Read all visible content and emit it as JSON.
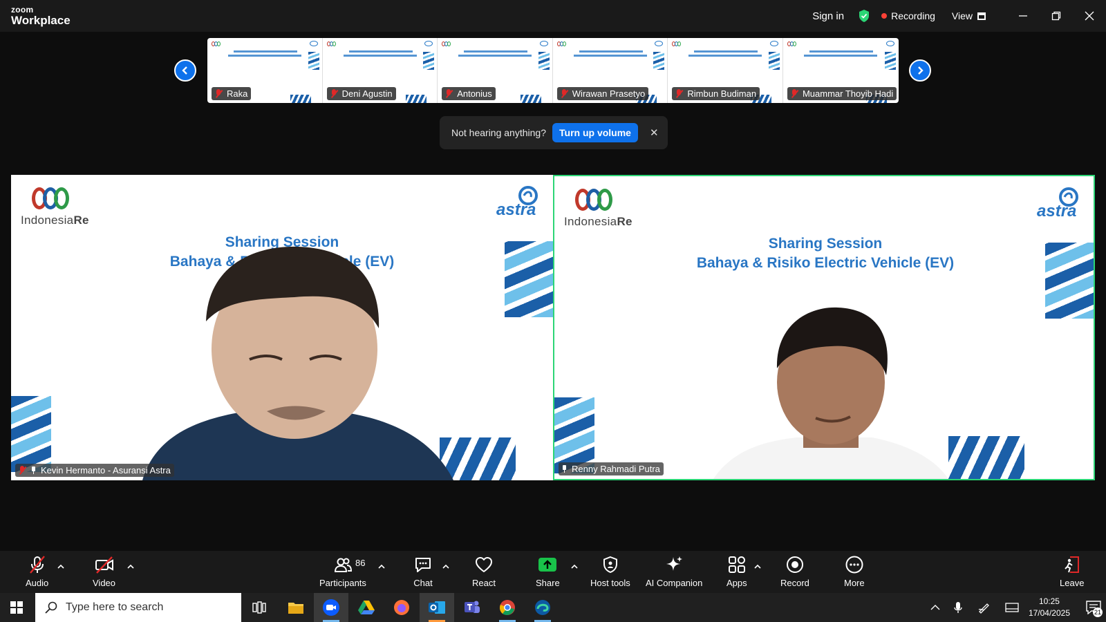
{
  "titlebar": {
    "logo_top": "zoom",
    "logo_bottom": "Workplace",
    "sign_in": "Sign in",
    "recording": "Recording",
    "view": "View",
    "accent_recording": "#ff4136",
    "accent_shield": "#2bd575"
  },
  "strip": {
    "participants": [
      {
        "name": "Raka"
      },
      {
        "name": "Deni Agustin"
      },
      {
        "name": "Antonius"
      },
      {
        "name": "Wirawan Prasetyo"
      },
      {
        "name": "Rimbun Budiman"
      },
      {
        "name": "Muammar Thoyib Hadi"
      }
    ]
  },
  "toast": {
    "message": "Not hearing anything?",
    "button": "Turn up volume",
    "close": "✕"
  },
  "tiles": {
    "left": {
      "name": "Kevin Hermanto - Asuransi Astra",
      "slide_title": "Sharing Session",
      "slide_subtitle": "Bahaya & Ri          ic Vehicle (EV)",
      "logo_text_a": "Indonesia",
      "logo_text_b": "Re"
    },
    "right": {
      "name": "Renny Rahmadi Putra",
      "slide_title": "Sharing Session",
      "slide_subtitle": "Bahaya & Risiko Electric Vehicle (EV)",
      "logo_text_a": "Indonesia",
      "logo_text_b": "Re",
      "active_speaker_color": "#2bd575"
    }
  },
  "toolbar": {
    "audio": "Audio",
    "video": "Video",
    "participants": "Participants",
    "participants_count": "86",
    "chat": "Chat",
    "react": "React",
    "share": "Share",
    "host_tools": "Host tools",
    "ai_companion": "AI Companion",
    "apps": "Apps",
    "record": "Record",
    "more": "More",
    "leave": "Leave",
    "share_color": "#19c24a",
    "muted_color": "#e02828"
  },
  "taskbar": {
    "search_placeholder": "Type here to search",
    "time": "10:25",
    "date": "17/04/2025",
    "notifications": "21"
  }
}
